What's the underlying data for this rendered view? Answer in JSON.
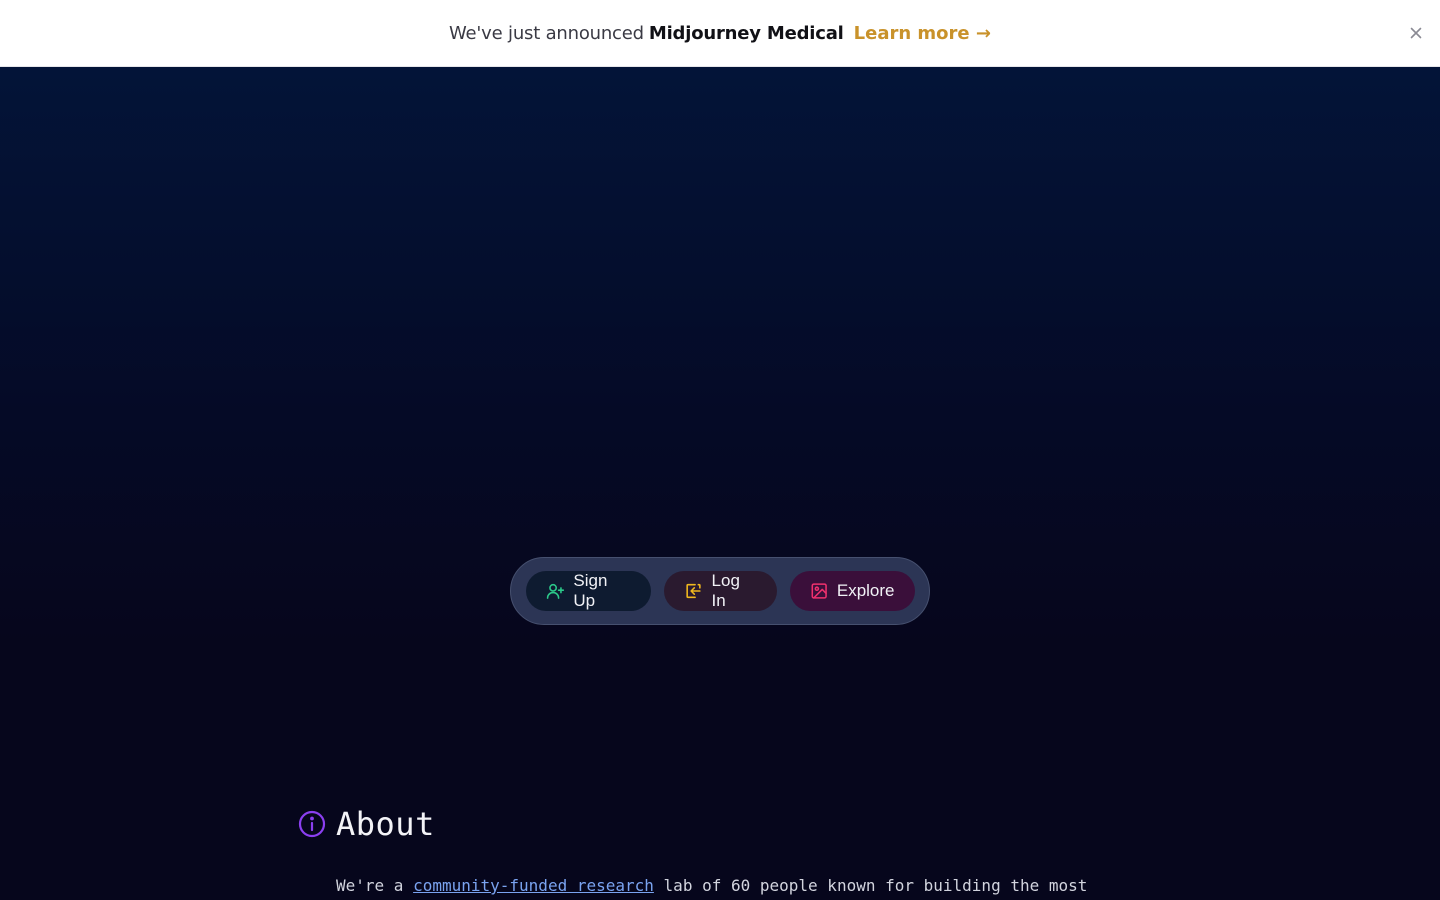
{
  "banner": {
    "prefix": "We've just announced",
    "highlight": "Midjourney Medical",
    "link_label": "Learn more →",
    "close_icon": "close-icon",
    "link_color": "#c9922a"
  },
  "actions": {
    "sign_up": {
      "label": "Sign Up",
      "icon": "user-plus-icon",
      "icon_color": "#2cc98a"
    },
    "log_in": {
      "label": "Log In",
      "icon": "log-in-icon",
      "icon_color": "#f0b81e"
    },
    "explore": {
      "label": "Explore",
      "icon": "image-icon",
      "icon_color": "#f0306e"
    }
  },
  "about": {
    "title": "About",
    "icon": "info-icon",
    "icon_color": "#8b3ff0",
    "text_before": "We're a",
    "link_text": "community-funded research",
    "text_after": "lab of 60 people known for building the most"
  }
}
